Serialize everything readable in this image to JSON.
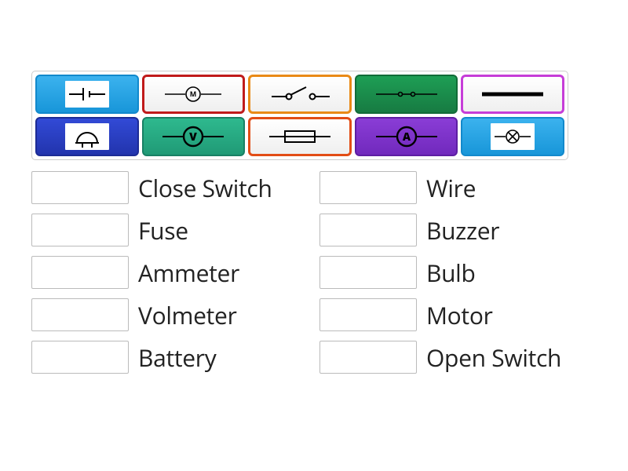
{
  "tiles": [
    {
      "id": "battery",
      "color_top": "#3bb2ee",
      "color_bot": "#1896d9",
      "border": "#1289cc",
      "card_bg": "#ffffff",
      "icon": "battery",
      "name": "battery-tile"
    },
    {
      "id": "motor",
      "color_top": "#ffffff",
      "color_bot": "#efefef",
      "border": "#c01b1b",
      "card_bg": "transparent",
      "icon": "motor",
      "name": "motor-tile"
    },
    {
      "id": "open-switch",
      "color_top": "#ffffff",
      "color_bot": "#efefef",
      "border": "#e98a17",
      "card_bg": "transparent",
      "icon": "open-switch",
      "name": "open-switch-tile"
    },
    {
      "id": "close-switch",
      "color_top": "#1e9e55",
      "color_bot": "#177b42",
      "border": "#126c38",
      "card_bg": "transparent",
      "icon": "close-switch",
      "name": "close-switch-tile"
    },
    {
      "id": "wire",
      "color_top": "#ffffff",
      "color_bot": "#efefef",
      "border": "#c63dd8",
      "card_bg": "transparent",
      "icon": "wire",
      "name": "wire-tile"
    },
    {
      "id": "buzzer",
      "color_top": "#324ad6",
      "color_bot": "#2234ad",
      "border": "#1c2b95",
      "card_bg": "#ffffff",
      "icon": "buzzer",
      "name": "buzzer-tile"
    },
    {
      "id": "voltmeter",
      "color_top": "#2eb98e",
      "color_bot": "#209a76",
      "border": "#188064",
      "card_bg": "transparent",
      "icon": "voltmeter",
      "name": "voltmeter-tile"
    },
    {
      "id": "fuse",
      "color_top": "#ffffff",
      "color_bot": "#efefef",
      "border": "#e24d15",
      "card_bg": "transparent",
      "icon": "fuse",
      "name": "fuse-tile"
    },
    {
      "id": "ammeter",
      "color_top": "#8a3dd6",
      "color_bot": "#7129bd",
      "border": "#5e1ea3",
      "card_bg": "transparent",
      "icon": "ammeter",
      "name": "ammeter-tile"
    },
    {
      "id": "bulb",
      "color_top": "#3bb2ee",
      "color_bot": "#1896d9",
      "border": "#1289cc",
      "card_bg": "#ffffff",
      "icon": "bulb",
      "name": "bulb-tile"
    }
  ],
  "answers": {
    "left": [
      {
        "label": "Close Switch",
        "slot_name": "close-switch-slot"
      },
      {
        "label": "Fuse",
        "slot_name": "fuse-slot"
      },
      {
        "label": "Ammeter",
        "slot_name": "ammeter-slot"
      },
      {
        "label": "Volmeter",
        "slot_name": "voltmeter-slot"
      },
      {
        "label": "Battery",
        "slot_name": "battery-slot"
      }
    ],
    "right": [
      {
        "label": "Wire",
        "slot_name": "wire-slot"
      },
      {
        "label": "Buzzer",
        "slot_name": "buzzer-slot"
      },
      {
        "label": "Bulb",
        "slot_name": "bulb-slot"
      },
      {
        "label": "Motor",
        "slot_name": "motor-slot"
      },
      {
        "label": "Open Switch",
        "slot_name": "open-switch-slot"
      }
    ]
  }
}
